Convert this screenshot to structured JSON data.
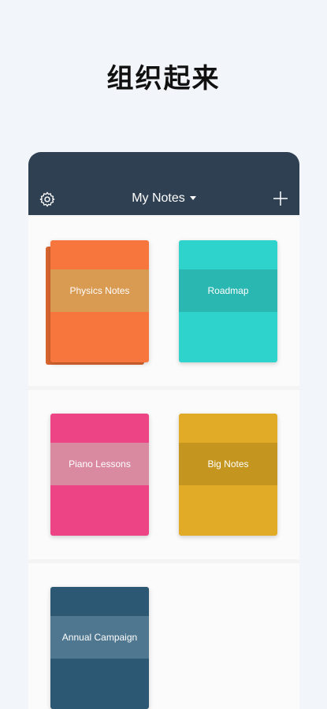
{
  "headline": "组织起来",
  "navbar": {
    "title": "My Notes",
    "settings_icon": "gear-icon",
    "add_icon": "plus-icon",
    "dropdown_icon": "caret-down-icon"
  },
  "notebooks": [
    {
      "title": "Physics Notes",
      "color": "#f6763d",
      "band_color": "#d99a52"
    },
    {
      "title": "Roadmap",
      "color": "#2ed3cb",
      "band_color": "#2ab6b1"
    },
    {
      "title": "Piano Lessons",
      "color": "#ec4485",
      "band_color": "#d98aa1"
    },
    {
      "title": "Big Notes",
      "color": "#e2ab27",
      "band_color": "#c4961f"
    },
    {
      "title": "Annual Campaign",
      "color": "#2c5873",
      "band_color": "#4f7790"
    }
  ]
}
